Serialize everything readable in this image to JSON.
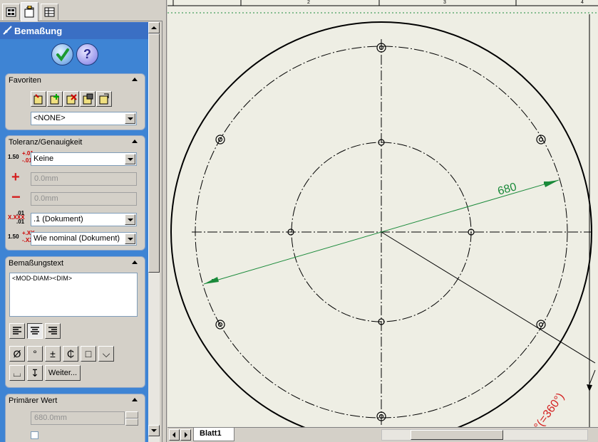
{
  "tabs": [
    {
      "icon": "feature-tree-icon"
    },
    {
      "icon": "property-manager-icon",
      "active": true
    },
    {
      "icon": "configuration-manager-icon"
    }
  ],
  "pm": {
    "title": "Bemaßung",
    "ok_icon": "checkmark-icon",
    "help_icon": "question-mark-icon"
  },
  "favoriten": {
    "title": "Favoriten",
    "buttons": [
      "apply-default-icon",
      "add-favorite-icon",
      "delete-favorite-icon",
      "save-favorite-icon",
      "load-favorite-icon"
    ],
    "selected": "<NONE>"
  },
  "toleranz": {
    "title": "Toleranz/Genauigkeit",
    "type_value": "Keine",
    "plus_value": "0.0mm",
    "minus_value": "0.0mm",
    "precision_value": ".1 (Dokument)",
    "tol_precision_value": "Wie nominal (Dokument)",
    "icon_label_1": "1.50",
    "icon_sup_1": "+.01",
    "icon_sub_1": "-.01",
    "icon_label_2": "X.XXX",
    "icon_sup_2": ".01",
    "icon_sub_2": ".01",
    "icon_label_3": "1.50",
    "icon_sup_3": "+.XX",
    "icon_sub_3": "-.XX"
  },
  "bemassungstext": {
    "title": "Bemaßungstext",
    "text": "<MOD-DIAM><DIM>",
    "align": [
      "align-left-icon",
      "align-center-icon",
      "align-right-icon"
    ],
    "symbols": [
      "Ø",
      "°",
      "±",
      "₵",
      "□",
      "⌵",
      "⌴",
      "↧"
    ],
    "weiter_label": "Weiter..."
  },
  "primaer": {
    "title": "Primärer Wert",
    "value": "680.0mm"
  },
  "drawing": {
    "dimension_value": "680",
    "angle_label": "°(=360°)",
    "ruler_ticks": [
      "2",
      "3",
      "4"
    ]
  },
  "statusbar": {
    "sheet_tab": "Blatt1"
  },
  "colors": {
    "pm_blue": "#3e84d4",
    "dimension_green": "#1a8a3a",
    "angle_red": "#d42020",
    "sheet_bg": "#eeeee4"
  }
}
